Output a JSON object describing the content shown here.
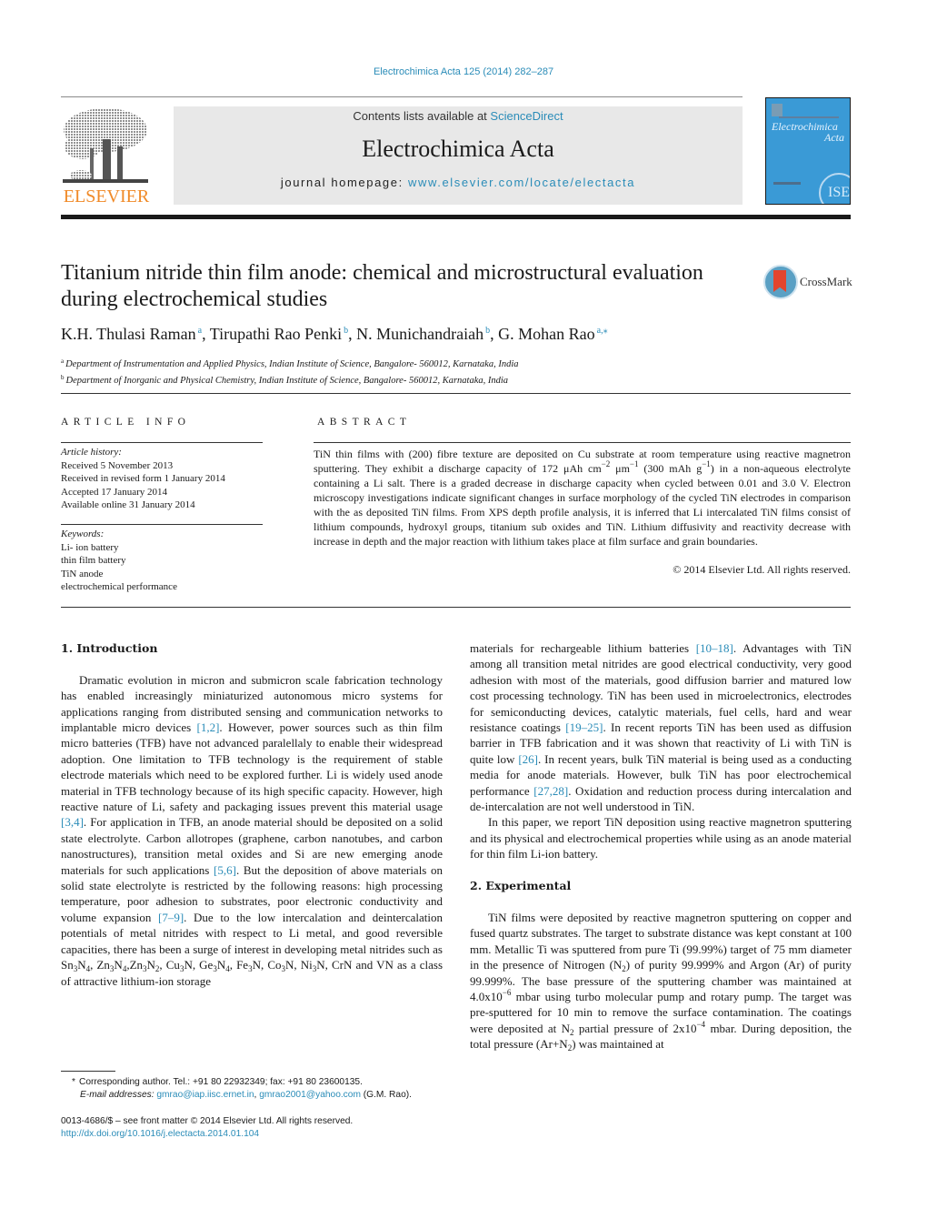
{
  "header": {
    "citation": "Electrochimica Acta 125 (2014) 282–287",
    "contents_prefix": "Contents lists available at ",
    "contents_link": "ScienceDirect",
    "journal_title": "Electrochimica Acta",
    "homepage_prefix": "journal homepage: ",
    "homepage_link": "www.elsevier.com/locate/electacta",
    "publisher_logo_text": "ELSEVIER",
    "cover": {
      "title_line1": "Electrochimica",
      "title_line2": "Acta",
      "badge": "ISE"
    },
    "colors": {
      "link": "#2a8cb8",
      "elsevier_orange": "#f08a28",
      "cover_blue": "#3a9ad6",
      "masthead_gray": "#e8e8e8"
    }
  },
  "article": {
    "title": "Titanium nitride thin film anode: chemical and microstructural evaluation during electrochemical studies",
    "crossmark_label": "CrossMark",
    "authors": [
      {
        "name": "K.H. Thulasi Raman",
        "aff": "a"
      },
      {
        "name": "Tirupathi Rao Penki",
        "aff": "b"
      },
      {
        "name": "N. Munichandraiah",
        "aff": "b"
      },
      {
        "name": "G. Mohan Rao",
        "aff": "a,⁎"
      }
    ],
    "affiliations": [
      {
        "key": "a",
        "text": "Department of Instrumentation and Applied Physics, Indian Institute of Science, Bangalore- 560012, Karnataka, India"
      },
      {
        "key": "b",
        "text": "Department of Inorganic and Physical Chemistry, Indian Institute of Science, Bangalore- 560012, Karnataka, India"
      }
    ]
  },
  "article_info": {
    "heading": "ARTICLE INFO",
    "history_label": "Article history:",
    "history": [
      "Received 5 November 2013",
      "Received in revised form 1 January 2014",
      "Accepted 17 January 2014",
      "Available online 31 January 2014"
    ],
    "keywords_label": "Keywords:",
    "keywords": [
      "Li- ion battery",
      "thin film battery",
      "TiN anode",
      "electrochemical performance"
    ]
  },
  "abstract": {
    "heading": "ABSTRACT",
    "p1": "TiN thin films with (200) fibre texture are deposited on Cu substrate at room temperature using reactive magnetron sputtering. They exhibit a discharge capacity of 172 μAh cm",
    "p1_exp1": "−2",
    "p1_mid": " μm",
    "p1_exp2": "−1",
    "p1_mid2": " (300 mAh g",
    "p1_exp3": "−1",
    "p1_rest": ") in a non-aqueous electrolyte containing a Li salt. There is a graded decrease in discharge capacity when cycled between 0.01 and 3.0 V. Electron microscopy investigations indicate significant changes in surface morphology of the cycled TiN electrodes in comparison with the as deposited TiN films. From XPS depth profile analysis, it is inferred that Li intercalated TiN films consist of lithium compounds, hydroxyl groups, titanium sub oxides and TiN. Lithium diffusivity and reactivity decrease with increase in depth and the major reaction with lithium takes place at film surface and grain boundaries.",
    "copyright": "© 2014 Elsevier Ltd. All rights reserved."
  },
  "body": {
    "intro_heading": "1.  Introduction",
    "intro": {
      "s1": "Dramatic evolution in micron and submicron scale fabrication technology has enabled increasingly miniaturized autonomous micro systems for applications ranging from distributed sensing and communication networks to implantable micro devices ",
      "r1": "[1,2]",
      "s2": ". However, power sources such as thin film micro batteries (TFB) have not advanced paralellaly to enable their widespread adoption. One limitation to TFB technology is the requirement of stable electrode materials which need to be explored further. Li is widely used anode material in TFB technology because of its high specific capacity. However, high reactive nature of Li, safety and packaging issues prevent this material usage ",
      "r2": "[3,4]",
      "s3": ". For application in TFB, an anode material should be deposited on a solid state electrolyte. Carbon allotropes (graphene, carbon nanotubes, and carbon nanostructures), transition metal oxides and Si are new emerging anode materials for such applications ",
      "r3": "[5,6]",
      "s4": ". But the deposition of above materials on solid state electrolyte is restricted by the following reasons: high processing temperature, poor adhesion to substrates, poor electronic conductivity and volume expansion ",
      "r4": "[7–9]",
      "s5": ". Due to the low intercalation and deintercalation potentials of metal nitrides with respect to Li metal, and good reversible capacities, there has been a surge of interest in developing metal nitrides such as Sn",
      "s6": ", CrN and VN as a class of attractive lithium-ion storage materials for rechargeable lithium batteries ",
      "r5": "[10–18]",
      "s7": ". Advantages with TiN among all transition metal nitrides are good electrical conductivity, very good adhesion with most of the materials, good diffusion barrier and matured low cost processing technology. TiN has been used in microelectronics, electrodes for semiconducting devices, catalytic materials, fuel cells, hard and wear resistance coatings ",
      "r6": "[19–25]",
      "s8": ". In recent reports TiN has been used as diffusion barrier in TFB fabrication and it was shown that reactivity of Li with TiN is quite low ",
      "r7": "[26]",
      "s9": ". In recent years, bulk TiN material is being used as a conducting media for anode materials. However, bulk TiN has poor electrochemical performance ",
      "r8": "[27,28]",
      "s10": ". Oxidation and reduction process during intercalation and de-intercalation are not well understood in TiN.",
      "p2": "In this paper, we report TiN deposition using reactive magnetron sputtering and its physical and electrochemical properties while using as an anode material for thin film Li-ion battery."
    },
    "exp_heading": "2.  Experimental",
    "exp": {
      "s1": "TiN films were deposited by reactive magnetron sputtering on copper and fused quartz substrates. The target to substrate distance was kept constant at 100 mm. Metallic Ti was sputtered from pure Ti (99.99%) target of 75 mm diameter in the presence of Nitrogen (N",
      "s2": ") of purity 99.999% and Argon (Ar) of purity 99.999%. The base pressure of the sputtering chamber was maintained at 4.0x10",
      "e1": "−6",
      "s3": " mbar using turbo molecular pump and rotary pump. The target was pre-sputtered for 10 min to remove the surface contamination. The coatings were deposited at N",
      "s4": " partial pressure of 2x10",
      "e2": "−4",
      "s5": " mbar. During deposition, the total pressure (Ar+N",
      "s6": ") was maintained at"
    }
  },
  "footnotes": {
    "star": "*",
    "corresponding": "Corresponding author. Tel.: +91 80 22932349; fax: +91 80 23600135.",
    "email_label": "E-mail addresses: ",
    "email1": "gmrao@iap.iisc.ernet.in",
    "email_sep": ", ",
    "email2": "gmrao2001@yahoo.com",
    "email_owner": " (G.M. Rao).",
    "issn": "0013-4686/$ – see front matter © 2014 Elsevier Ltd. All rights reserved.",
    "doi": "http://dx.doi.org/10.1016/j.electacta.2014.01.104"
  }
}
